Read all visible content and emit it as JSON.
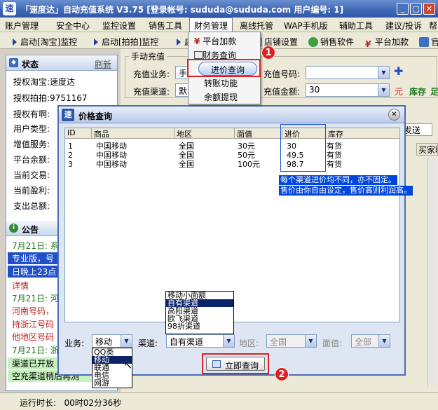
{
  "window": {
    "title": "「速度达」自动充值系统 V3.75 [登录帐号: sududa@sududa.com 用户编号: 1]",
    "logo": "速"
  },
  "menu": [
    "账户管理",
    "安全中心",
    "监控设置",
    "销售工具",
    "财务管理",
    "离线托管",
    "WAP手机版",
    "辅助工具",
    "建议/投诉",
    "帮"
  ],
  "menu_dropdown": {
    "items": [
      "平台加款",
      "财务查询",
      "进价查询",
      "转账功能",
      "余额提现"
    ]
  },
  "toolbar": [
    "启动[淘宝]监控",
    "启动[拍拍]监控",
    "启",
    "店铺设置",
    "销售软件",
    "平台加款",
    "官"
  ],
  "left_panel": {
    "status_title": "状态",
    "refresh": "刷新",
    "rows": [
      {
        "label": "授权淘宝:",
        "value": "速度达"
      },
      {
        "label": "授权拍拍:",
        "value": "9751167"
      },
      {
        "label": "授权有啊:",
        "value": ""
      },
      {
        "label": "用户类型:",
        "value": ""
      },
      {
        "label": "增值服务:",
        "value": ""
      },
      {
        "label": "平台余额:",
        "value": ""
      },
      {
        "label": "当前交易:",
        "value": ""
      },
      {
        "label": "当前盈利:",
        "value": ""
      },
      {
        "label": "支出总额:",
        "value": ""
      }
    ],
    "notice_title": "公告",
    "notices": [
      "7月21日: 系",
      "专业版，号",
      "日晚上23点",
      "详情",
      "7月21日: 河",
      "河南号码，",
      "持浙江号码",
      "他地区号码",
      "7月21日: 浙",
      "渠道已开放",
      "空充渠道稍后再测"
    ]
  },
  "manual": {
    "group_title": "手动充值",
    "biz_label": "充值业务:",
    "biz_value": "手",
    "channel_label": "充值渠道:",
    "channel_value": "默",
    "number_label": "充值号码:",
    "amount_label": "充值金额:",
    "amount_value": "30",
    "unit": "元",
    "stock": "库存",
    "stock_tail": "足",
    "send_tab": "发送",
    "buyer_col": "买家昵"
  },
  "dialog": {
    "logo": "速",
    "title": "价格查询",
    "columns": [
      "ID",
      "商品",
      "地区",
      "面值",
      "进价",
      "库存"
    ],
    "rows": [
      [
        "1",
        "中国移动",
        "全国",
        "30元",
        "30",
        "有货"
      ],
      [
        "2",
        "中国移动",
        "全国",
        "50元",
        "49.5",
        "有货"
      ],
      [
        "3",
        "中国移动",
        "全国",
        "100元",
        "98.7",
        "有货"
      ]
    ],
    "note_lines": [
      "每个渠道进价均不同，亦不固定。",
      "售价由你自由设定，售价高则利润高。"
    ],
    "channel_options": [
      "移动小面额",
      "自有渠道",
      "高阳渠道",
      "欧飞渠道",
      "98折渠道"
    ],
    "channel_selected": "自有渠道",
    "biz_options": [
      "QQ类",
      "移动",
      "联通",
      "电信",
      "网游"
    ],
    "biz_selected": "移动",
    "biz_label": "业务:",
    "channel_label": "渠道:",
    "region_label": "地区:",
    "region_value": "全国",
    "face_label": "面值:",
    "face_value": "全部",
    "query_button": "立即查询",
    "badge1": "1",
    "badge2": "2"
  },
  "statusbar": {
    "run_time": "运行时长:   00时02分36秒"
  }
}
